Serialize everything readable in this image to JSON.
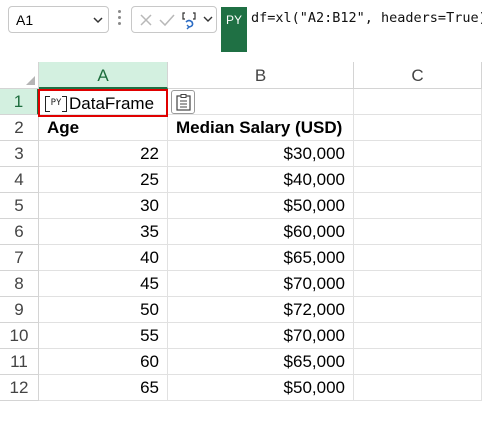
{
  "formula_bar": {
    "name_box": "A1",
    "python_badge": "PY",
    "formula": "df=xl(\"A2:B12\", headers=True)"
  },
  "columns": [
    "A",
    "B",
    "C"
  ],
  "a1": {
    "icon_label": "PY",
    "value": "DataFrame"
  },
  "row_numbers": [
    "1",
    "2",
    "3",
    "4",
    "5",
    "6",
    "7",
    "8",
    "9",
    "10",
    "11",
    "12"
  ],
  "table": {
    "headers": [
      "Age",
      "Median Salary (USD)"
    ],
    "rows": [
      [
        "22",
        "$30,000"
      ],
      [
        "25",
        "$40,000"
      ],
      [
        "30",
        "$50,000"
      ],
      [
        "35",
        "$60,000"
      ],
      [
        "40",
        "$65,000"
      ],
      [
        "45",
        "$70,000"
      ],
      [
        "50",
        "$72,000"
      ],
      [
        "55",
        "$70,000"
      ],
      [
        "60",
        "$65,000"
      ],
      [
        "65",
        "$50,000"
      ]
    ]
  },
  "icons": {
    "name_box_dropdown": "chevron-down-icon",
    "cancel": "close-icon",
    "enter": "check-icon",
    "function": "python-function-icon",
    "formula_dropdown": "chevron-down-icon",
    "card": "card-view-icon"
  },
  "colors": {
    "python_green": "#1f7044",
    "selection_outline": "#e00000",
    "header_selected_bg": "#d3f0e0"
  }
}
